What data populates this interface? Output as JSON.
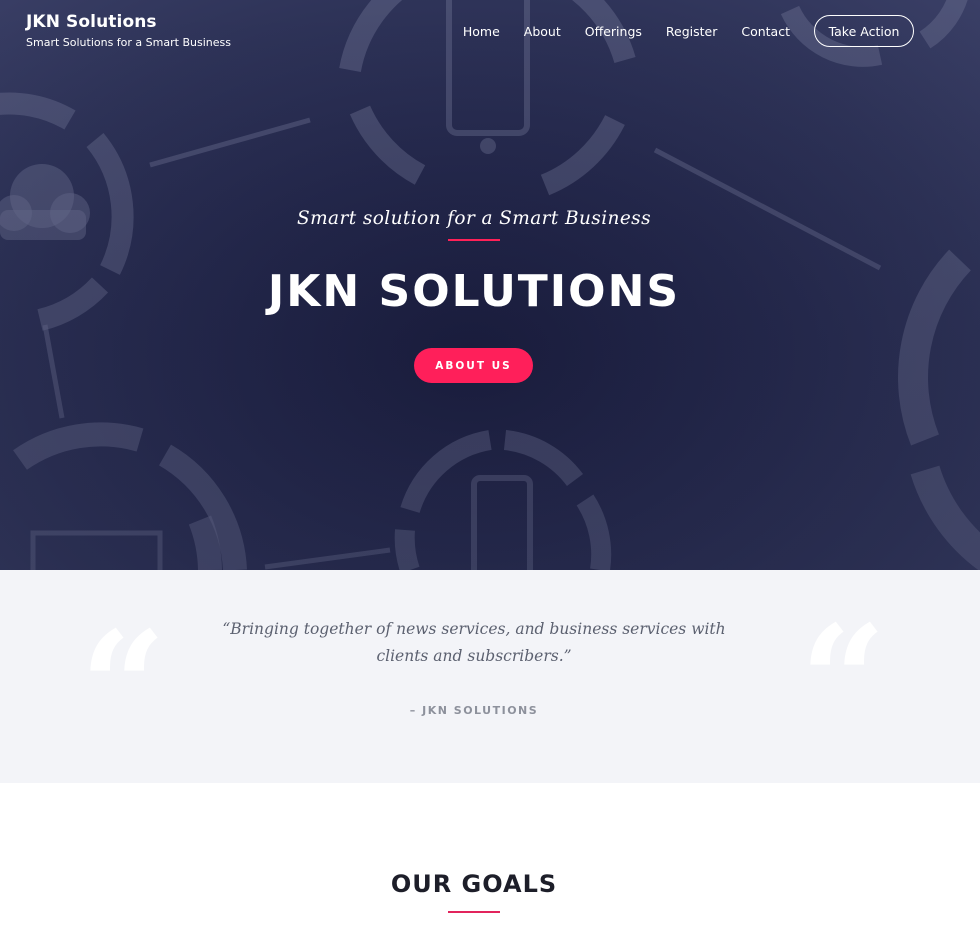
{
  "brand": {
    "title": "JKN Solutions",
    "tagline": "Smart Solutions for a Smart Business"
  },
  "nav": {
    "items": [
      "Home",
      "About",
      "Offerings",
      "Register",
      "Contact"
    ],
    "cta": "Take Action"
  },
  "hero": {
    "subtitle": "Smart solution for a Smart Business",
    "title": "JKN SOLUTIONS",
    "button": "ABOUT US"
  },
  "quote": {
    "text": "“Bringing together of news services, and business services with clients and subscribers.”",
    "author": "– JKN SOLUTIONS"
  },
  "goals": {
    "title": "OUR GOALS"
  },
  "colors": {
    "accent": "#ff1f5a",
    "hero_bg": "#24284c",
    "quote_bg": "#f3f4f8"
  }
}
